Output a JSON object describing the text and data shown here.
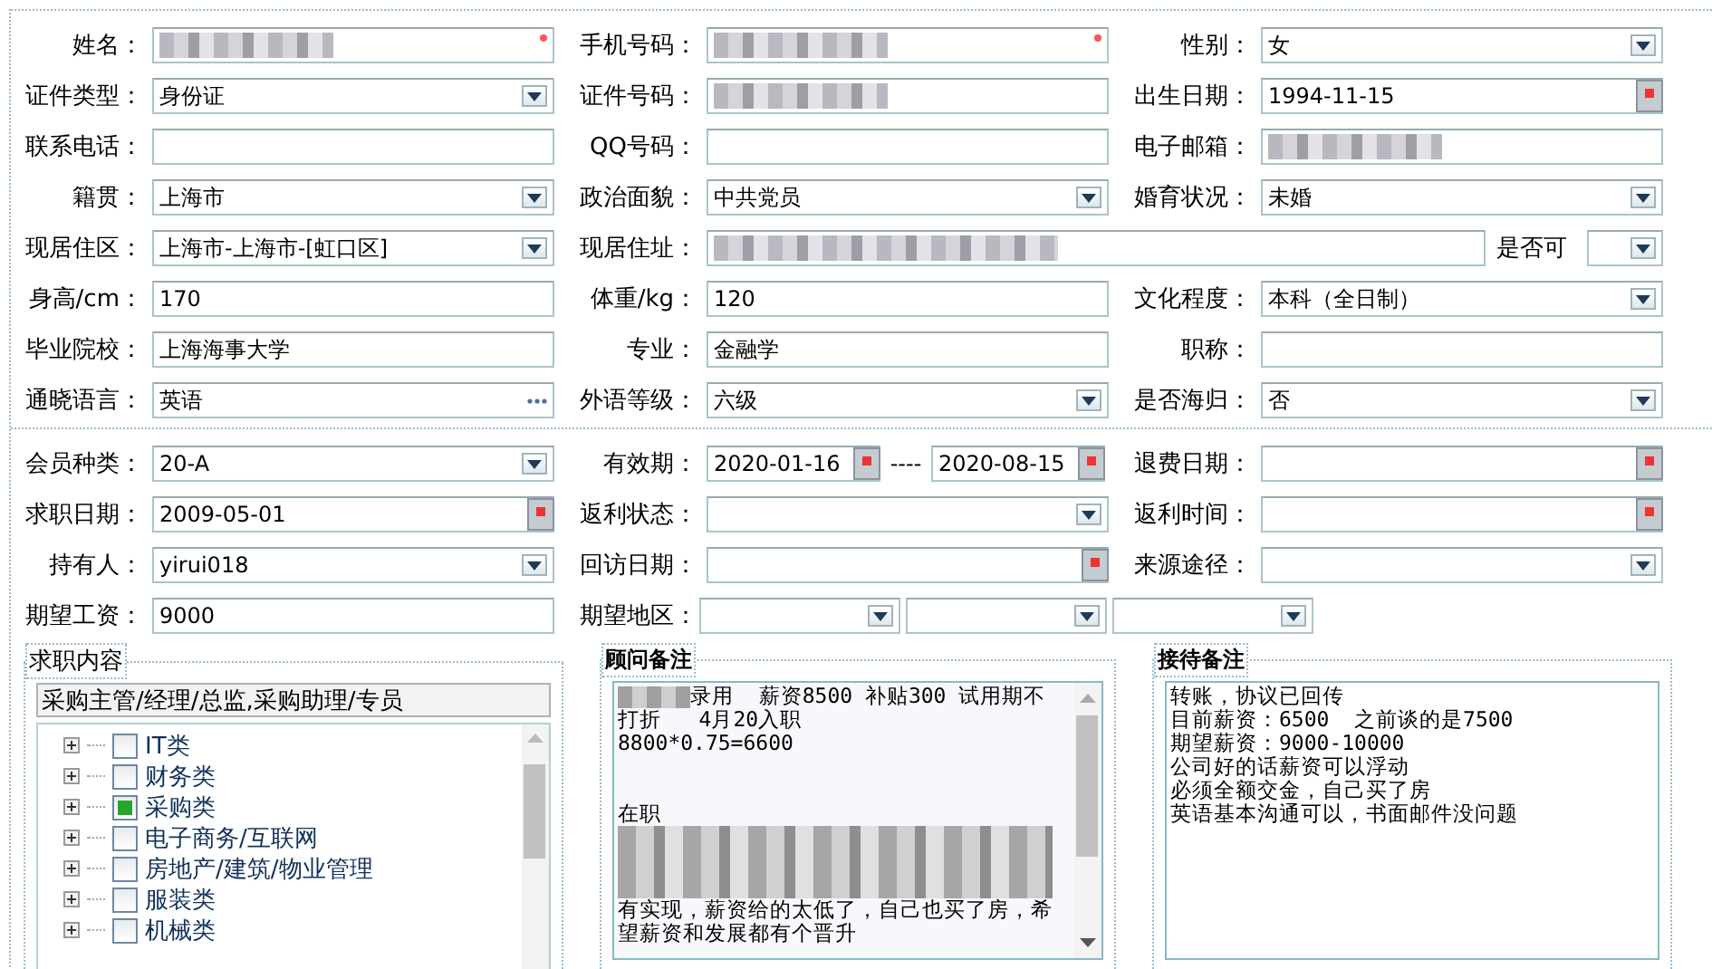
{
  "sections": [
    {
      "rows": [
        [
          {
            "label": "姓名：",
            "kind": "text",
            "redacted": true,
            "required": true
          },
          {
            "label": "手机号码：",
            "kind": "text",
            "redacted": true,
            "required": true
          },
          {
            "label": "性别：",
            "kind": "select",
            "value": "女"
          }
        ],
        [
          {
            "label": "证件类型：",
            "kind": "select",
            "value": "身份证"
          },
          {
            "label": "证件号码：",
            "kind": "text",
            "redacted": true
          },
          {
            "label": "出生日期：",
            "kind": "date",
            "value": "1994-11-15"
          }
        ],
        [
          {
            "label": "联系电话：",
            "kind": "text"
          },
          {
            "label": "QQ号码：",
            "kind": "text"
          },
          {
            "label": "电子邮箱：",
            "kind": "text",
            "redacted": true
          }
        ],
        [
          {
            "label": "籍贯：",
            "kind": "select",
            "value": "上海市"
          },
          {
            "label": "政治面貌：",
            "kind": "select",
            "value": "中共党员"
          },
          {
            "label": "婚育状况：",
            "kind": "select",
            "value": "未婚"
          }
        ],
        [
          {
            "label": "现居住区：",
            "kind": "select",
            "value": "上海市-上海市-[虹口区]"
          },
          {
            "label": "现居住址：",
            "kind": "text",
            "redacted": true,
            "wide": true
          },
          {
            "label": "是否可",
            "kind": "mini_select"
          }
        ],
        [
          {
            "label": "身高/cm：",
            "kind": "text",
            "value": "170"
          },
          {
            "label": "体重/kg：",
            "kind": "text",
            "value": "120"
          },
          {
            "label": "文化程度：",
            "kind": "select",
            "value": "本科（全日制）"
          }
        ],
        [
          {
            "label": "毕业院校：",
            "kind": "text",
            "value": "上海海事大学"
          },
          {
            "label": "专业：",
            "kind": "text",
            "value": "金融学"
          },
          {
            "label": "职称：",
            "kind": "text"
          }
        ],
        [
          {
            "label": "通晓语言：",
            "kind": "picker",
            "value": "英语"
          },
          {
            "label": "外语等级：",
            "kind": "select",
            "value": "六级"
          },
          {
            "label": "是否海归：",
            "kind": "select",
            "value": "否"
          }
        ]
      ]
    },
    {
      "rows": [
        [
          {
            "label": "会员种类：",
            "kind": "select",
            "value": "20-A"
          },
          {
            "label": "有效期：",
            "kind": "date_range",
            "values": [
              "2020-01-16",
              "2020-08-15"
            ],
            "separator": "----"
          },
          {
            "label": "退费日期：",
            "kind": "date"
          }
        ],
        [
          {
            "label": "求职日期：",
            "kind": "date",
            "value": "2009-05-01"
          },
          {
            "label": "返利状态：",
            "kind": "select"
          },
          {
            "label": "返利时间：",
            "kind": "date"
          }
        ],
        [
          {
            "label": "持有人：",
            "kind": "select",
            "value": "yirui018"
          },
          {
            "label": "回访日期：",
            "kind": "date"
          },
          {
            "label": "来源途径：",
            "kind": "select"
          }
        ],
        [
          {
            "label": "期望工资：",
            "kind": "text",
            "value": "9000"
          },
          {
            "label": "期望地区：",
            "kind": "multi_select",
            "parts": [
              {
                "kind": "select"
              },
              {
                "kind": "select"
              },
              {
                "kind": "select"
              }
            ]
          }
        ]
      ]
    }
  ],
  "panels": [
    {
      "kind": "job",
      "title": "求职内容",
      "summary": "采购主管/经理/总监,采购助理/专员",
      "tree": [
        {
          "label": "IT类",
          "checked": false
        },
        {
          "label": "财务类",
          "checked": false
        },
        {
          "label": "采购类",
          "checked": true
        },
        {
          "label": "电子商务/互联网",
          "checked": false
        },
        {
          "label": "房地产/建筑/物业管理",
          "checked": false
        },
        {
          "label": "服装类",
          "checked": false
        },
        {
          "label": "机械类",
          "checked": false
        }
      ]
    },
    {
      "kind": "notes",
      "title": "顾问备注",
      "scroll": true,
      "lines": [
        {
          "kind": "text",
          "text": "录用  薪资8500 补贴300 试用期不打折   4月20入职",
          "redacted_prefix": true
        },
        {
          "kind": "text",
          "text": "8800*0.75=6600"
        },
        {
          "kind": "gap"
        },
        {
          "kind": "text",
          "text": "在职"
        },
        {
          "kind": "redacted"
        },
        {
          "kind": "text",
          "text": "有实现，薪资给的太低了，自己也买了房，希望薪资和发展都有个晋升"
        }
      ]
    },
    {
      "kind": "notes",
      "title": "接待备注",
      "scroll": false,
      "lines": [
        {
          "kind": "text",
          "text": "转账，协议已回传"
        },
        {
          "kind": "text",
          "text": "目前薪资：6500  之前谈的是7500"
        },
        {
          "kind": "text",
          "text": "期望薪资：9000-10000"
        },
        {
          "kind": "text",
          "text": "公司好的话薪资可以浮动"
        },
        {
          "kind": "text",
          "text": "必须全额交金，自己买了房"
        },
        {
          "kind": "text",
          "text": "英语基本沟通可以，书面邮件没问题"
        }
      ]
    }
  ]
}
